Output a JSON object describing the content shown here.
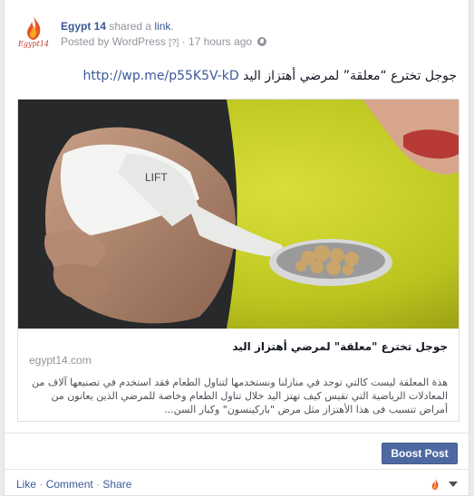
{
  "post": {
    "author": "Egypt 14",
    "action_pre": "shared a",
    "action_link": "link",
    "action_post": ".",
    "posted_by": "Posted by WordPress",
    "help_mark": "[?]",
    "separator": "·",
    "time": "17 hours ago",
    "avatar_text": "Egypt14",
    "text_arabic": "جوجل تخترع “معلقة” لمرضي أهتزاز اليد",
    "text_link": "http://wp.me/p55K5V-kD"
  },
  "share": {
    "title": "جوجل تخترع \"معلقة\" لمرضي أهتزاز اليد",
    "domain": "egypt14.com",
    "description": "هذة المعلقة ليست كالتي توجد في منازلنا ونستخدمها لتناول الطعام فقد استخدم في تصنيعها آلاف من المعادلات الرياضية التي تقيس كيف تهتز اليد خلال تناول الطعام وخاصة للمرضي الذين يعانون من أمراض تتسبب فى هذا الأهتزاز مثل مرض \"باركينسون\" وكبار السن...",
    "image_alt": "spoon-photo"
  },
  "boost": {
    "label": "Boost Post"
  },
  "actions": {
    "like": "Like",
    "comment": "Comment",
    "share": "Share",
    "dot": "·"
  },
  "colors": {
    "link": "#3b5998",
    "button": "#4e69a2",
    "muted": "#90949c",
    "brand": "#e8522a"
  },
  "icons": [
    "egypt14-logo",
    "globe-icon",
    "dropdown-caret-icon"
  ]
}
